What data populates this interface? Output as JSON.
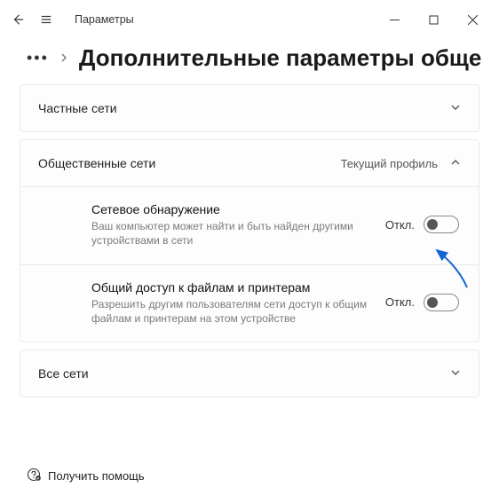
{
  "app_title": "Параметры",
  "page_title": "Дополнительные параметры обще",
  "sections": {
    "private": {
      "title": "Частные сети"
    },
    "public": {
      "title": "Общественные сети",
      "badge": "Текущий профиль",
      "items": [
        {
          "title": "Сетевое обнаружение",
          "desc": "Ваш компьютер может найти и быть найден другими устройствами в сети",
          "state": "Откл."
        },
        {
          "title": "Общий доступ к файлам и принтерам",
          "desc": "Разрешить другим пользователям сети доступ к общим файлам и принтерам на этом устройстве",
          "state": "Откл."
        }
      ]
    },
    "all": {
      "title": "Все сети"
    }
  },
  "footer": {
    "help": "Получить помощь"
  }
}
